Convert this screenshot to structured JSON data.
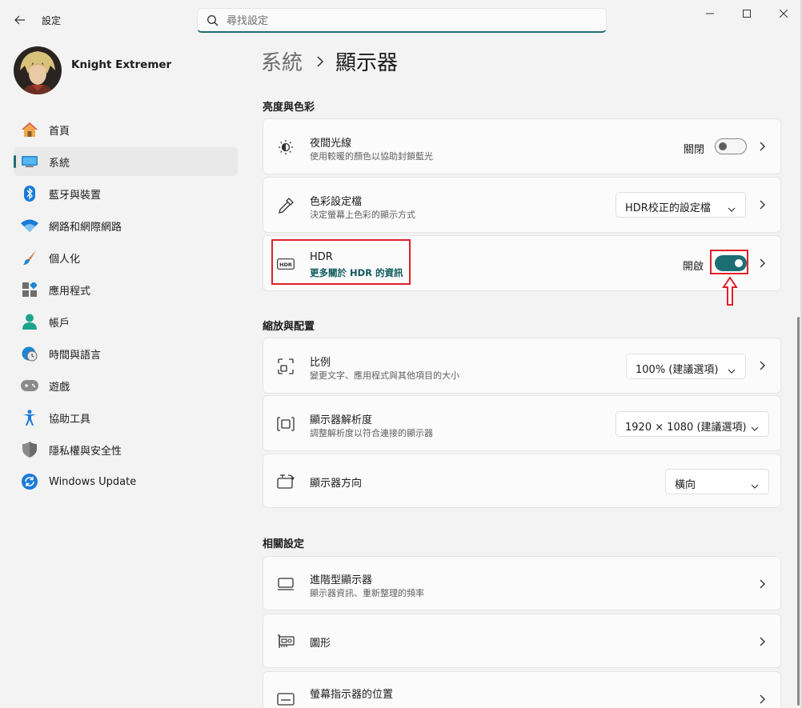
{
  "window": {
    "app_title": "設定",
    "search_placeholder": "尋找設定"
  },
  "user": {
    "name": "Knight Extremer"
  },
  "nav": {
    "items": [
      {
        "label": "首頁",
        "icon": "home-icon"
      },
      {
        "label": "系統",
        "icon": "system-icon",
        "active": true
      },
      {
        "label": "藍牙與裝置",
        "icon": "bluetooth-icon"
      },
      {
        "label": "網路和網際網路",
        "icon": "wifi-icon"
      },
      {
        "label": "個人化",
        "icon": "brush-icon"
      },
      {
        "label": "應用程式",
        "icon": "apps-icon"
      },
      {
        "label": "帳戶",
        "icon": "account-icon"
      },
      {
        "label": "時間與語言",
        "icon": "clock-globe-icon"
      },
      {
        "label": "遊戲",
        "icon": "gamepad-icon"
      },
      {
        "label": "協助工具",
        "icon": "accessibility-icon"
      },
      {
        "label": "隱私權與安全性",
        "icon": "shield-icon"
      },
      {
        "label": "Windows Update",
        "icon": "update-icon"
      }
    ]
  },
  "breadcrumb": {
    "parent": "系統",
    "current": "顯示器"
  },
  "sections": {
    "brightness_color": "亮度與色彩",
    "scale_layout": "縮放與配置",
    "related": "相關設定"
  },
  "night_light": {
    "title": "夜間光線",
    "subtitle": "使用較暖的顏色以協助封鎖藍光",
    "state": "關閉",
    "on": false
  },
  "color_profile": {
    "title": "色彩設定檔",
    "subtitle": "決定螢幕上色彩的顯示方式",
    "value": "HDR校正的設定檔"
  },
  "hdr": {
    "title": "HDR",
    "link": "更多關於 HDR 的資訊",
    "state": "開啟",
    "on": true
  },
  "scale": {
    "title": "比例",
    "subtitle": "變更文字、應用程式與其他項目的大小",
    "value": "100% (建議選項)"
  },
  "resolution": {
    "title": "顯示器解析度",
    "subtitle": "調整解析度以符合連接的顯示器",
    "value": "1920 × 1080 (建議選項)"
  },
  "orientation": {
    "title": "顯示器方向",
    "value": "橫向"
  },
  "advanced_display": {
    "title": "進階型顯示器",
    "subtitle": "顯示器資訊、重新整理的頻率"
  },
  "graphics": {
    "title": "圖形"
  },
  "pointer_location": {
    "title": "螢幕指示器的位置",
    "subtitle": ""
  },
  "colors": {
    "accent": "#1d6e73",
    "highlight": "#e0202a"
  }
}
